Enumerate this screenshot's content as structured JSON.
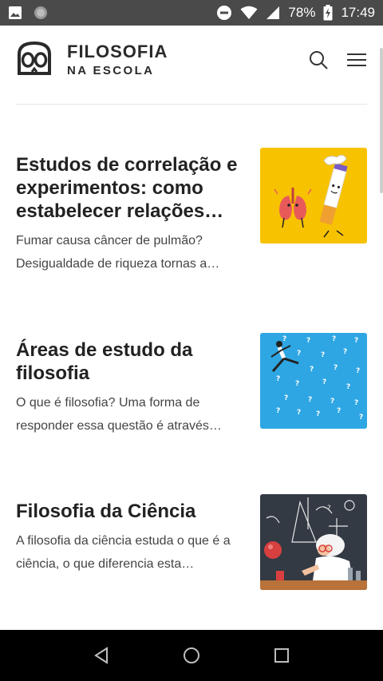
{
  "status_bar": {
    "battery_percent": "78%",
    "time": "17:49"
  },
  "header": {
    "brand_top": "FILOSOFIA",
    "brand_bottom": "NA ESCOLA"
  },
  "articles": [
    {
      "title": "Estudos de correlação e experimentos: como estabelecer relações…",
      "excerpt": "Fumar causa câncer de pulmão? Desigualdade de riqueza tornas a…",
      "thumb_bg": "#f7c200"
    },
    {
      "title": "Áreas de estudo da filosofia",
      "excerpt": "O que é filosofia? Uma forma de responder essa questão é através…",
      "thumb_bg": "#2ea6e3"
    },
    {
      "title": "Filosofia da Ciência",
      "excerpt": "A filosofia da ciência estuda o que é a ciência, o que diferencia esta…",
      "thumb_bg": "#333a44"
    }
  ]
}
